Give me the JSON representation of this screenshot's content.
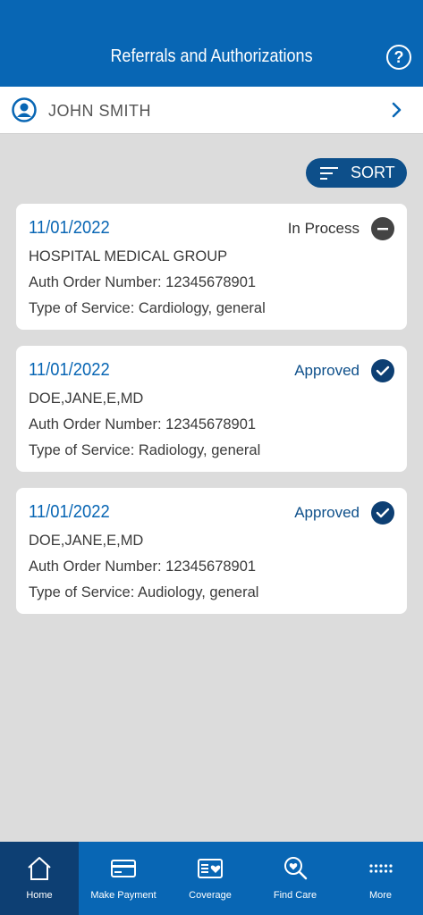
{
  "header": {
    "title": "Referrals and Authorizations",
    "help_icon": "question-circle-icon",
    "help_symbol": "?"
  },
  "member": {
    "name": "JOHN SMITH",
    "avatar_icon": "user-circle-icon",
    "chevron_icon": "chevron-right-icon"
  },
  "sort": {
    "label": "SORT",
    "icon": "sort-lines-icon"
  },
  "referrals": [
    {
      "date": "11/01/2022",
      "status": "In Process",
      "status_icon": "minus-circle-icon",
      "provider": "HOSPITAL MEDICAL GROUP",
      "auth_order": "Auth Order Number: 12345678901",
      "service": "Type of Service: Cardiology, general"
    },
    {
      "date": "11/01/2022",
      "status": "Approved",
      "status_icon": "check-circle-icon",
      "provider": "DOE,JANE,E,MD",
      "auth_order": "Auth Order Number: 12345678901",
      "service": "Type of Service: Radiology, general"
    },
    {
      "date": "11/01/2022",
      "status": "Approved",
      "status_icon": "check-circle-icon",
      "provider": "DOE,JANE,E,MD",
      "auth_order": "Auth Order Number: 12345678901",
      "service": "Type of Service: Audiology, general"
    }
  ],
  "tabs": [
    {
      "label": "Home",
      "icon": "home-icon",
      "active": true
    },
    {
      "label": "Make Payment",
      "icon": "credit-card-icon",
      "active": false
    },
    {
      "label": "Coverage",
      "icon": "id-card-icon",
      "active": false
    },
    {
      "label": "Find Care",
      "icon": "search-heart-icon",
      "active": false
    },
    {
      "label": "More",
      "icon": "more-dots-icon",
      "active": false
    }
  ],
  "colors": {
    "brand_blue": "#0866b4",
    "dark_blue": "#0d3f73",
    "background": "#dcdcdc"
  }
}
